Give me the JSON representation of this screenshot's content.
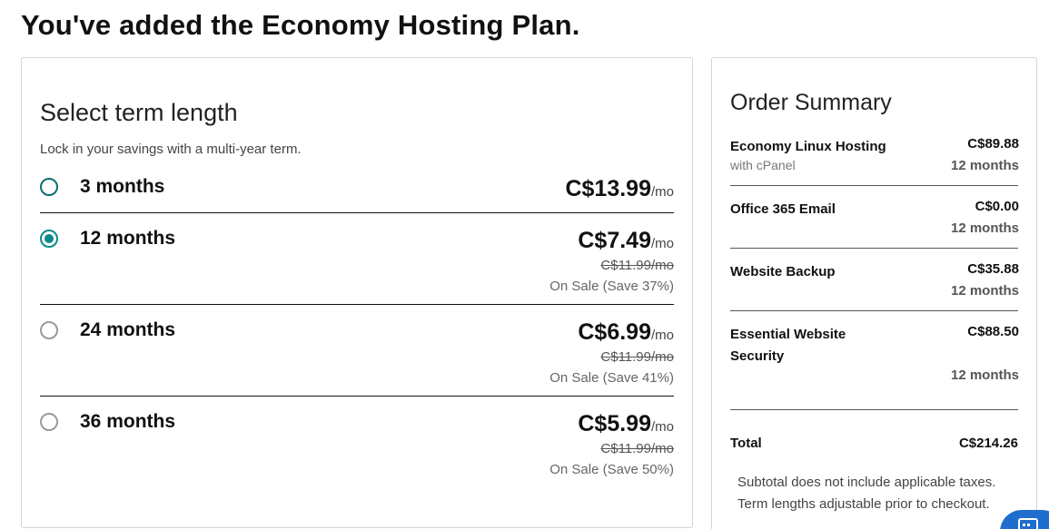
{
  "page": {
    "title": "You've added the Economy Hosting Plan."
  },
  "term": {
    "heading": "Select term length",
    "subtitle": "Lock in your savings with a multi-year term.",
    "options": [
      {
        "label": "3 months",
        "price": "C$13.99",
        "per": "/mo",
        "was": "",
        "sale": "",
        "selected": false
      },
      {
        "label": "12 months",
        "price": "C$7.49",
        "per": "/mo",
        "was": "C$11.99/mo",
        "sale": "On Sale (Save 37%)",
        "selected": true
      },
      {
        "label": "24 months",
        "price": "C$6.99",
        "per": "/mo",
        "was": "C$11.99/mo",
        "sale": "On Sale (Save 41%)",
        "selected": false
      },
      {
        "label": "36 months",
        "price": "C$5.99",
        "per": "/mo",
        "was": "C$11.99/mo",
        "sale": "On Sale (Save 50%)",
        "selected": false
      }
    ]
  },
  "summary": {
    "title": "Order Summary",
    "items": [
      {
        "name": "Economy Linux Hosting",
        "sub": "with cPanel",
        "amount": "C$89.88",
        "term": "12 months"
      },
      {
        "name": "Office 365 Email",
        "sub": "",
        "amount": "C$0.00",
        "term": "12 months"
      },
      {
        "name": "Website Backup",
        "sub": "",
        "amount": "C$35.88",
        "term": "12 months"
      },
      {
        "name": "Essential Website Security",
        "sub": "",
        "amount": "C$88.50",
        "term": "12 months"
      }
    ],
    "total_label": "Total",
    "total_amount": "C$214.26",
    "note_line1": "Subtotal does not include applicable taxes.",
    "note_line2": "Term lengths adjustable prior to checkout."
  },
  "chat": {
    "icon": "chat-icon",
    "color": "#1f6dcc"
  },
  "colors": {
    "accent": "#0b8a8a"
  }
}
